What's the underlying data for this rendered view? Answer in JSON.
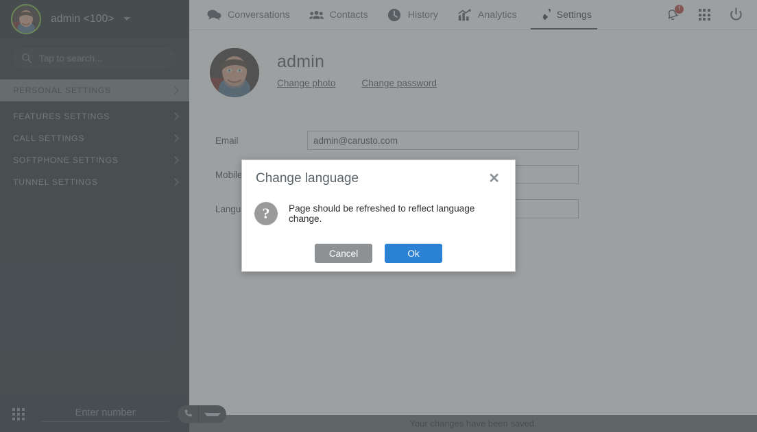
{
  "sidebar": {
    "user_label": "admin <100>",
    "user_caret": "chevron-down-icon",
    "search_placeholder": "Tap to search...",
    "search_value": "",
    "items": [
      {
        "label": "PERSONAL SETTINGS",
        "active": true
      },
      {
        "label": "FEATURES SETTINGS",
        "active": false
      },
      {
        "label": "CALL SETTINGS",
        "active": false
      },
      {
        "label": "SOFTPHONE SETTINGS",
        "active": false
      },
      {
        "label": "TUNNEL SETTINGS",
        "active": false
      }
    ],
    "dialer": {
      "keypad_icon": "grid-keypad-icon",
      "number_placeholder": "Enter number",
      "number_value": "",
      "call_icon": "phone-icon",
      "call_dropdown_icon": "chevron-down-icon"
    }
  },
  "topbar": {
    "tabs": [
      {
        "label": "Conversations",
        "icon": "chat-bubbles-icon",
        "active": false
      },
      {
        "label": "Contacts",
        "icon": "people-icon",
        "active": false
      },
      {
        "label": "History",
        "icon": "clock-icon",
        "active": false
      },
      {
        "label": "Analytics",
        "icon": "chart-line-icon",
        "active": false
      },
      {
        "label": "Settings",
        "icon": "gears-icon",
        "active": true
      }
    ],
    "actions": [
      {
        "name": "notifications-bell",
        "icon": "bell-icon",
        "badge": "!"
      },
      {
        "name": "apps-grid",
        "icon": "grid-apps-icon",
        "badge": ""
      },
      {
        "name": "power-logout",
        "icon": "power-icon",
        "badge": ""
      }
    ]
  },
  "profile": {
    "name": "admin",
    "change_photo_label": "Change photo",
    "change_password_label": "Change password",
    "avatar_alt": "user-avatar"
  },
  "form": {
    "rows": [
      {
        "label": "Email",
        "value": "admin@carusto.com",
        "type": "text"
      },
      {
        "label": "Mobile",
        "value": "",
        "type": "text"
      },
      {
        "label": "Language",
        "value": "",
        "type": "select"
      }
    ]
  },
  "statusbar": {
    "message": "Your changes have been saved."
  },
  "modal": {
    "title": "Change language",
    "close_icon": "close-icon",
    "info_icon": "question-mark-icon",
    "message": "Page should be refreshed to reflect language change.",
    "cancel_label": "Cancel",
    "ok_label": "Ok"
  },
  "colors": {
    "sidebar_bg": "#222a2d",
    "sidebar_active": "#70797c",
    "accent_blue": "#2b82d4",
    "cancel_gray": "#8e9194",
    "badge_red": "#b93b33",
    "online_green": "#7cc142",
    "statusbar_bg": "#5f6569"
  }
}
